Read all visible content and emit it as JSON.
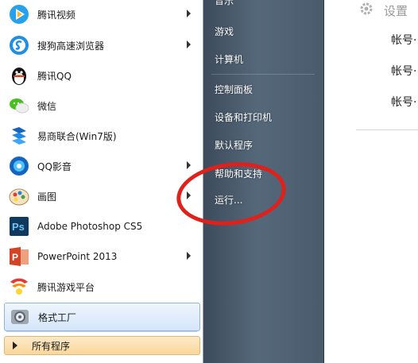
{
  "start_menu": {
    "programs": [
      {
        "label": "腾讯视频",
        "icon": "tencent-video-icon",
        "has_submenu": true
      },
      {
        "label": "搜狗高速浏览器",
        "icon": "sogou-browser-icon",
        "has_submenu": true
      },
      {
        "label": "腾讯QQ",
        "icon": "qq-penguin-icon",
        "has_submenu": false
      },
      {
        "label": "微信",
        "icon": "wechat-icon",
        "has_submenu": false
      },
      {
        "label": "易商联合(Win7版)",
        "icon": "yishang-icon",
        "has_submenu": false
      },
      {
        "label": "QQ影音",
        "icon": "qq-player-icon",
        "has_submenu": true
      },
      {
        "label": "画图",
        "icon": "paint-icon",
        "has_submenu": true
      },
      {
        "label": "Adobe Photoshop CS5",
        "icon": "photoshop-icon",
        "has_submenu": false
      },
      {
        "label": "PowerPoint 2013",
        "icon": "powerpoint-icon",
        "has_submenu": true
      },
      {
        "label": "腾讯游戏平台",
        "icon": "tencent-games-icon",
        "has_submenu": false
      },
      {
        "label": "格式工厂",
        "icon": "format-factory-icon",
        "has_submenu": false,
        "selected": true
      }
    ],
    "all_programs": "所有程序",
    "right_pane": [
      {
        "label": "音乐"
      },
      {
        "label": "游戏"
      },
      {
        "label": "计算机"
      },
      {
        "label": "控制面板"
      },
      {
        "label": "设备和打印机"
      },
      {
        "label": "默认程序"
      },
      {
        "label": "帮助和支持"
      },
      {
        "label": "运行..."
      }
    ]
  },
  "settings_window": {
    "title": "设置",
    "accounts": [
      "帐号·",
      "帐号·",
      "帐号·"
    ]
  },
  "colors": {
    "annotation_red": "#e0201b",
    "selected_blue": "#d5e6fa",
    "all_programs_orange": "#fad79b"
  }
}
